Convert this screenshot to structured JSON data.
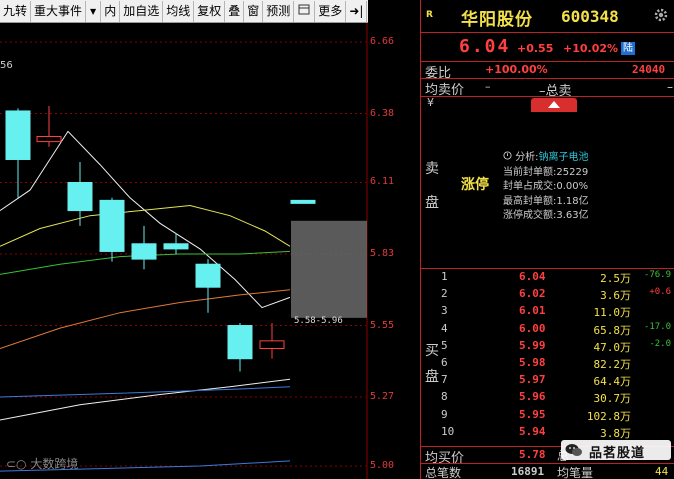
{
  "toolbar": {
    "items": [
      "九转",
      "重大事件",
      "内",
      "加自选",
      "均线",
      "复权",
      "叠",
      "窗",
      "预测",
      "更多"
    ],
    "pin_label": "➜|"
  },
  "chart": {
    "ma_value": "56",
    "price_labels": [
      "6.66",
      "6.38",
      "6.11",
      "5.83",
      "5.55",
      "5.27",
      "5.00"
    ],
    "range_label": "5.58-5.96",
    "watermark": "大数跨境",
    "colors": {
      "up": "#ff4040",
      "down": "#66f0f0",
      "grid": "#8b0000",
      "label": "#e03a3a"
    }
  },
  "chart_data": {
    "type": "candlestick",
    "price_axis": [
      "5.00",
      "5.27",
      "5.55",
      "5.83",
      "6.11",
      "6.38",
      "6.66"
    ],
    "ylim": [
      5.0,
      6.66
    ],
    "candles": [
      {
        "open": 6.2,
        "close": 6.39,
        "high": 6.4,
        "low": 6.05,
        "dir": "down"
      },
      {
        "open": 6.27,
        "close": 6.29,
        "high": 6.41,
        "low": 6.25,
        "dir": "up"
      },
      {
        "open": 6.11,
        "close": 6.0,
        "high": 6.19,
        "low": 5.94,
        "dir": "down"
      },
      {
        "open": 6.04,
        "close": 5.84,
        "high": 6.05,
        "low": 5.8,
        "dir": "down"
      },
      {
        "open": 5.87,
        "close": 5.81,
        "high": 5.94,
        "low": 5.77,
        "dir": "down"
      },
      {
        "open": 5.87,
        "close": 5.85,
        "high": 5.91,
        "low": 5.83,
        "dir": "down"
      },
      {
        "open": 5.79,
        "close": 5.7,
        "high": 5.81,
        "low": 5.6,
        "dir": "down"
      },
      {
        "open": 5.55,
        "close": 5.42,
        "high": 5.56,
        "low": 5.37,
        "dir": "down"
      },
      {
        "open": 5.46,
        "close": 5.49,
        "high": 5.56,
        "low": 5.42,
        "dir": "up"
      },
      {
        "open": 6.04,
        "close": 6.04,
        "high": 6.04,
        "low": 6.04,
        "dir": "down"
      }
    ],
    "prediction_range": [
      5.58,
      5.96
    ]
  },
  "stock": {
    "tag": "R",
    "name": "华阳股份",
    "code": "600348",
    "price": "6.04",
    "change": "+0.55",
    "change_pct": "+10.02%",
    "board": "陆"
  },
  "orderbook": {
    "wb_label": "委比",
    "wb_value": "+100.00%",
    "wc_value": "24040",
    "avg_sell_label": "均卖价",
    "avg_sell_value": "–",
    "total_sell_label": "–总卖",
    "total_sell_value": "–",
    "yen": "¥",
    "sell_vertical": [
      "卖",
      "盘"
    ],
    "buy_vertical": [
      "买",
      "盘"
    ],
    "limit_tag": "涨停",
    "analysis": {
      "title_key": "分析:",
      "title_val": "钠离子电池",
      "lines": [
        {
          "k": "当前封单额:",
          "v": "25229"
        },
        {
          "k": "封单占成交:",
          "v": "0.00%"
        },
        {
          "k": "最高封单额:",
          "v": "1.18亿"
        },
        {
          "k": "涨停成交额:",
          "v": "3.63亿"
        }
      ]
    },
    "bids": [
      {
        "level": "1",
        "price": "6.04",
        "vol": "2.5万",
        "chg": "-76.9"
      },
      {
        "level": "2",
        "price": "6.02",
        "vol": "3.6万",
        "chg": "+0.6"
      },
      {
        "level": "3",
        "price": "6.01",
        "vol": "11.0万",
        "chg": ""
      },
      {
        "level": "4",
        "price": "6.00",
        "vol": "65.8万",
        "chg": "-17.0"
      },
      {
        "level": "5",
        "price": "5.99",
        "vol": "47.0万",
        "chg": "-2.0"
      },
      {
        "level": "6",
        "price": "5.98",
        "vol": "82.2万",
        "chg": ""
      },
      {
        "level": "7",
        "price": "5.97",
        "vol": "64.4万",
        "chg": ""
      },
      {
        "level": "8",
        "price": "5.96",
        "vol": "30.7万",
        "chg": ""
      },
      {
        "level": "9",
        "price": "5.95",
        "vol": "102.8万",
        "chg": ""
      },
      {
        "level": "10",
        "price": "5.94",
        "vol": "3.8万",
        "chg": ""
      }
    ],
    "avg_buy_label": "均买价",
    "avg_buy_value": "5.78",
    "total_buy_label": "总",
    "count_label": "总笔数",
    "count_value": "16891",
    "per_trade_label": "均笔量",
    "per_trade_value": "44"
  },
  "brand": {
    "label": "品茗股道"
  }
}
